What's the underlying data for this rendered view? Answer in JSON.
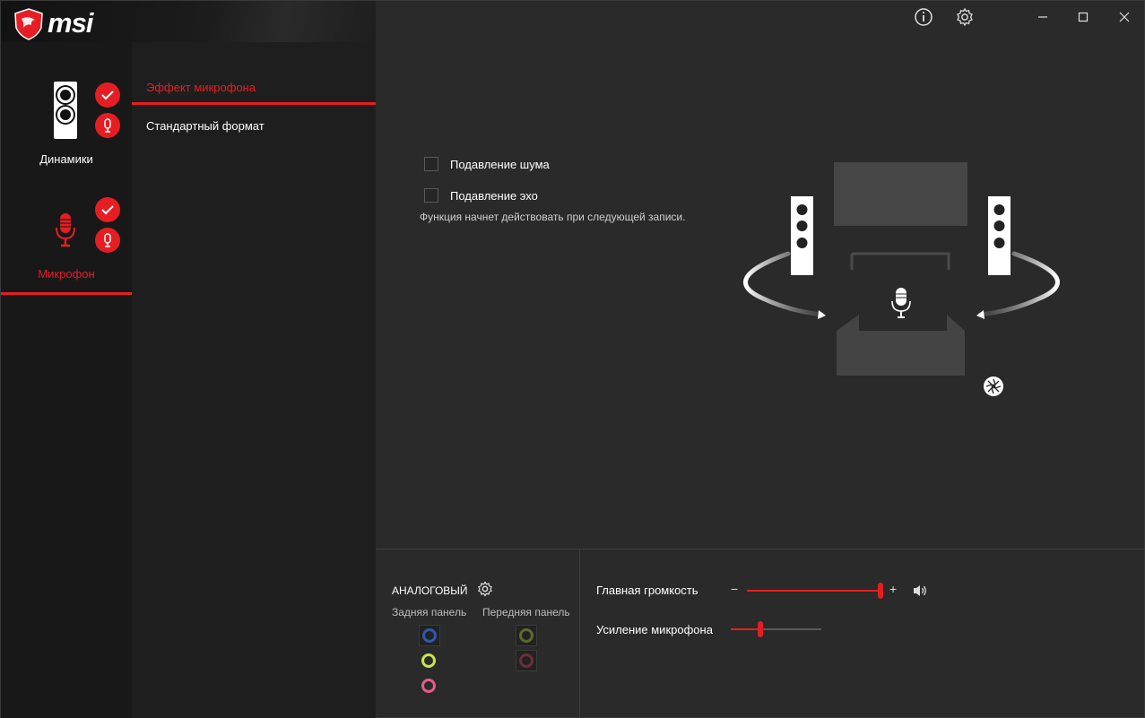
{
  "brand": {
    "logo_text": "msi"
  },
  "devices": [
    {
      "label": "Динамики",
      "active": false
    },
    {
      "label": "Микрофон",
      "active": true
    }
  ],
  "menu": [
    {
      "label": "Эффект микрофона",
      "active": true
    },
    {
      "label": "Стандартный формат",
      "active": false
    }
  ],
  "window_controls": [
    "info-icon",
    "settings-icon",
    "minimize-icon",
    "maximize-icon",
    "close-icon"
  ],
  "effects": {
    "noise_suppression": {
      "label": "Подавление шума",
      "checked": false
    },
    "echo_cancellation": {
      "label": "Подавление эхо",
      "checked": false
    },
    "hint": "Функция начнет действовать при следующей записи."
  },
  "analog": {
    "title": "АНАЛОГОВЫЙ",
    "rear_label": "Задняя панель",
    "front_label": "Передняя панель",
    "rear_jacks": [
      {
        "color": "#2e5aa8",
        "selected": true
      },
      {
        "color": "#c7e54a",
        "selected": false
      },
      {
        "color": "#e85a8c",
        "selected": false
      }
    ],
    "front_jacks": [
      {
        "color": "#5c6b2a",
        "selected": true
      },
      {
        "color": "#6b2d3c",
        "selected": true
      }
    ]
  },
  "volume": {
    "main_label": "Главная громкость",
    "main_level": 1.0,
    "minus": "−",
    "plus": "+",
    "mic_boost_label": "Усиление микрофона",
    "mic_boost_level": 0.33
  },
  "colors": {
    "accent": "#e51e24",
    "background": "#2a2a2a",
    "sidebar": "#181818"
  }
}
